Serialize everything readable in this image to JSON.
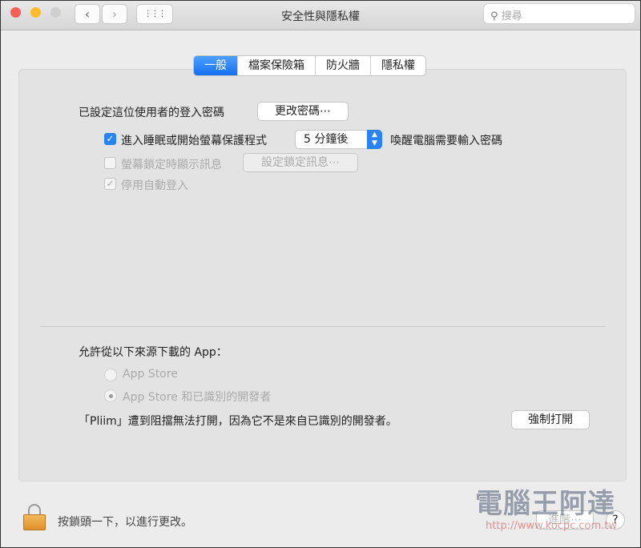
{
  "window": {
    "title": "安全性與隱私權",
    "search_placeholder": "搜尋",
    "back": "‹",
    "forward": "›",
    "grid": "⋮⋮⋮"
  },
  "tabs": [
    {
      "label": "一般",
      "active": true
    },
    {
      "label": "檔案保險箱"
    },
    {
      "label": "防火牆"
    },
    {
      "label": "隱私權"
    }
  ],
  "general": {
    "password_label": "已設定這位使用者的登入密碼",
    "change_password": "更改密碼⋯",
    "require_password": {
      "checked": true,
      "label": "進入睡眠或開始螢幕保護程式",
      "select_value": "5 分鐘後",
      "suffix": "喚醒電腦需要輸入密碼"
    },
    "show_message": {
      "checked": false,
      "label": "螢幕鎖定時顯示訊息",
      "button": "設定鎖定訊息⋯"
    },
    "disable_autologin": {
      "checked": true,
      "label": "停用自動登入"
    }
  },
  "downloads": {
    "label": "允許從以下來源下載的 App：",
    "options": [
      {
        "label": "App Store",
        "selected": false
      },
      {
        "label": "App Store 和已識別的開發者",
        "selected": true
      }
    ],
    "blocked_message": "「Pliim」遭到阻擋無法打開，因為它不是來自已識別的開發者。",
    "open_anyway": "強制打開"
  },
  "footer": {
    "lock_text": "按鎖頭一下，以進行更改。",
    "advanced": "進階⋯",
    "help": "?"
  },
  "watermark": {
    "text": "電腦王阿達",
    "url": "http://www.kocpc.com.tw"
  },
  "colors": {
    "accent": "#2a82f7",
    "close": "#fc5f57",
    "minimize": "#fdbc2e",
    "disabled": "#cfcfcf"
  }
}
